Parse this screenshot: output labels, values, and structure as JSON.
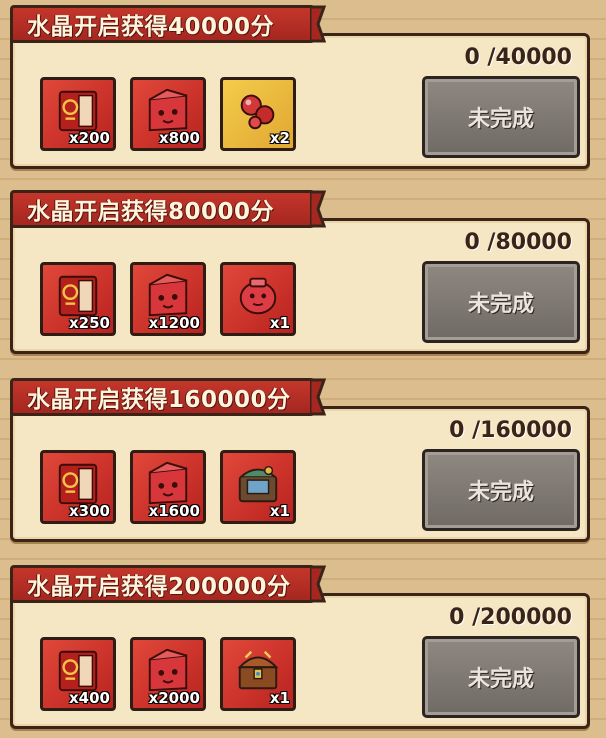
{
  "tiers": [
    {
      "title": "水晶开启获得40000分",
      "progress": "0 /40000",
      "button_label": "未完成",
      "rewards": [
        {
          "icon": "red-book-icon",
          "count": "x200"
        },
        {
          "icon": "red-crystal-box-icon",
          "count": "x800"
        },
        {
          "icon": "red-gem-pack-icon",
          "count": "x2"
        }
      ]
    },
    {
      "title": "水晶开启获得80000分",
      "progress": "0 /80000",
      "button_label": "未完成",
      "rewards": [
        {
          "icon": "red-book-icon",
          "count": "x250"
        },
        {
          "icon": "red-crystal-box-icon",
          "count": "x1200"
        },
        {
          "icon": "red-gem-pot-icon",
          "count": "x1"
        }
      ]
    },
    {
      "title": "水晶开启获得160000分",
      "progress": "0 /160000",
      "button_label": "未完成",
      "rewards": [
        {
          "icon": "red-book-icon",
          "count": "x300"
        },
        {
          "icon": "red-crystal-box-icon",
          "count": "x1600"
        },
        {
          "icon": "treasure-bundle-icon",
          "count": "x1"
        }
      ]
    },
    {
      "title": "水晶开启获得200000分",
      "progress": "0 /200000",
      "button_label": "未完成",
      "rewards": [
        {
          "icon": "red-book-icon",
          "count": "x400"
        },
        {
          "icon": "red-crystal-box-icon",
          "count": "x2000"
        },
        {
          "icon": "treasure-chest-icon",
          "count": "x1"
        }
      ]
    }
  ]
}
